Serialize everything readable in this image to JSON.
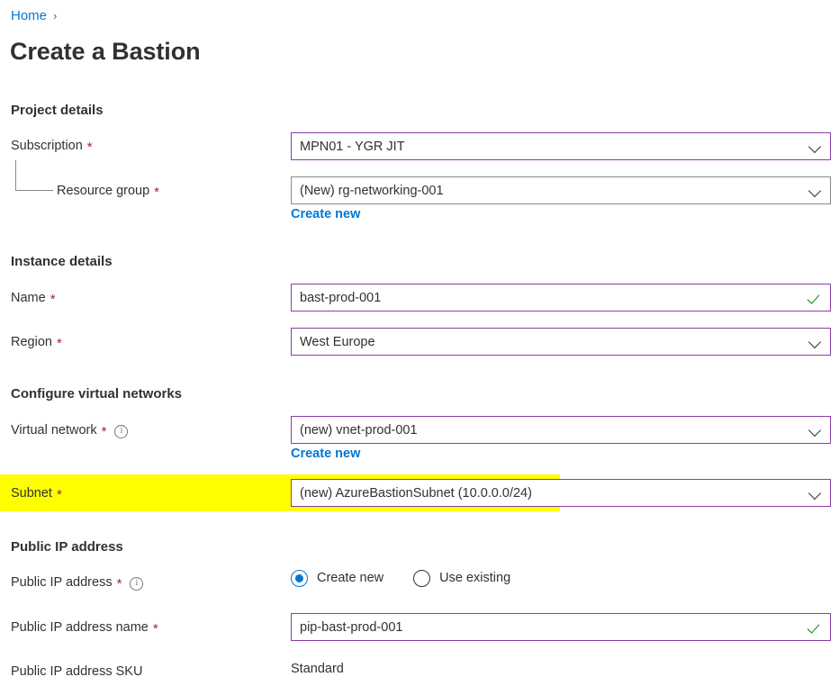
{
  "breadcrumb": {
    "home_label": "Home",
    "separator": "›"
  },
  "page_title": "Create a Bastion",
  "sections": {
    "project_details": {
      "heading": "Project details",
      "subscription": {
        "label": "Subscription",
        "required": "*",
        "value": "MPN01 - YGR JIT"
      },
      "resource_group": {
        "label": "Resource group",
        "required": "*",
        "value": "(New) rg-networking-001",
        "create_new": "Create new"
      }
    },
    "instance_details": {
      "heading": "Instance details",
      "name": {
        "label": "Name",
        "required": "*",
        "value": "bast-prod-001"
      },
      "region": {
        "label": "Region",
        "required": "*",
        "value": "West Europe"
      }
    },
    "configure_virtual_networks": {
      "heading": "Configure virtual networks",
      "virtual_network": {
        "label": "Virtual network",
        "required": "*",
        "value": "(new) vnet-prod-001",
        "create_new": "Create new"
      },
      "subnet": {
        "label": "Subnet",
        "required": "*",
        "value": "(new) AzureBastionSubnet (10.0.0.0/24)"
      }
    },
    "public_ip_address": {
      "heading": "Public IP address",
      "public_ip_address": {
        "label": "Public IP address",
        "required": "*",
        "options": [
          {
            "label": "Create new",
            "selected": true
          },
          {
            "label": "Use existing",
            "selected": false
          }
        ]
      },
      "public_ip_address_name": {
        "label": "Public IP address name",
        "required": "*",
        "value": "pip-bast-prod-001"
      },
      "public_ip_address_sku": {
        "label": "Public IP address SKU",
        "value": "Standard"
      }
    }
  },
  "colors": {
    "link": "#0078d4",
    "required_asterisk": "#a4262c",
    "field_border_active": "#8a3ea1",
    "field_border_default": "#8a8886",
    "valid_check": "#107c10",
    "highlight": "#ffff00",
    "text": "#323130"
  }
}
